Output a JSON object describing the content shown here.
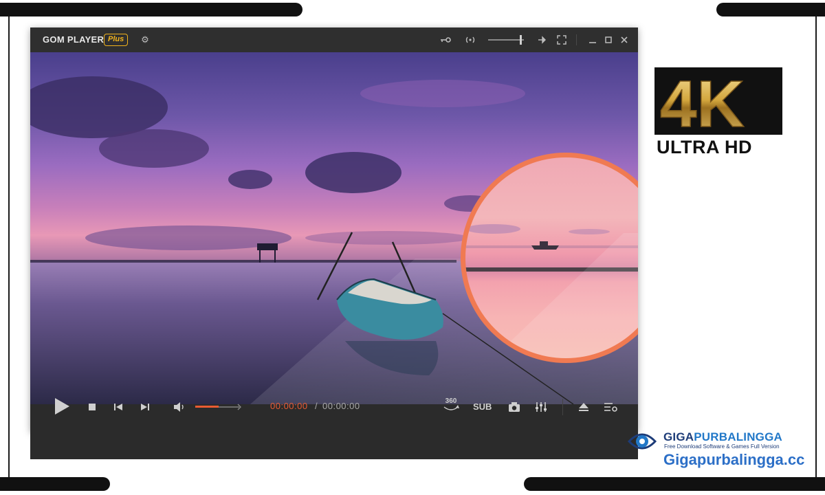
{
  "app": {
    "brand": "GOM PLAYER",
    "badge": "Plus"
  },
  "titlebar": {
    "icons": [
      "gear-icon",
      "key-icon",
      "radio-signal-icon",
      "pin-icon",
      "fullscreen-icon",
      "minimize-icon",
      "restore-icon",
      "close-icon"
    ],
    "volume_level_fraction": 0.95
  },
  "playback": {
    "current_time": "00:00:00",
    "separator": "/",
    "total_time": "00:00:00",
    "volume_fraction": 0.53,
    "vr_label": "360",
    "subtitle_label": "SUB"
  },
  "badge_4k": {
    "big": "4K",
    "sub": "ULTRA HD"
  },
  "watermark": {
    "title_a": "GIGA",
    "title_b": "PURBALINGGA",
    "tagline": "Free Download Software & Games Full Version",
    "url": "Gigapurbalingga.cc"
  },
  "colors": {
    "accent": "#ea5b32",
    "badge_gold": "#f2b31c",
    "zoom_ring": "#f07a52",
    "watermark_blue": "#2c6fc7"
  }
}
